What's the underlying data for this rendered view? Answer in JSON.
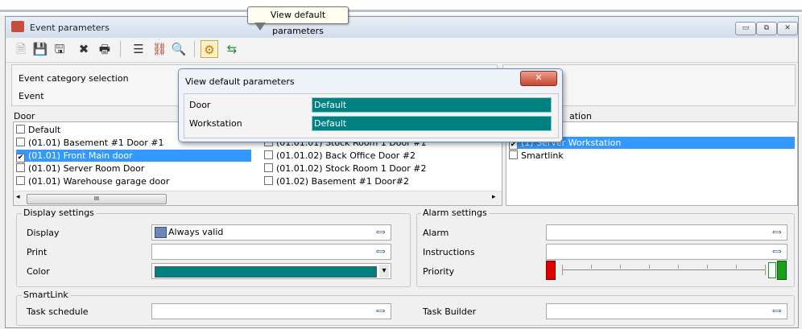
{
  "tooltip": "View default parameters",
  "window": {
    "title": "Event parameters",
    "controls": {
      "minimize": "▭",
      "restore": "⧉",
      "close": "✕"
    }
  },
  "toolbar": {
    "buttons": [
      {
        "name": "new-icon",
        "glyph": "🗎"
      },
      {
        "name": "save-icon",
        "glyph": "💾"
      },
      {
        "name": "save-as-icon",
        "glyph": "🖫"
      },
      {
        "name": "delete-icon",
        "glyph": "✖"
      },
      {
        "name": "print-icon",
        "glyph": "🖶"
      },
      {
        "name": "list-icon",
        "glyph": "☰"
      },
      {
        "name": "link-icon",
        "glyph": "⛓"
      },
      {
        "name": "search-icon",
        "glyph": "🔍"
      },
      {
        "name": "default-parameters-icon",
        "glyph": "⚙"
      },
      {
        "name": "export-icon",
        "glyph": "⇆"
      }
    ]
  },
  "header": {
    "category_label": "Event category selection",
    "event_label": "Event"
  },
  "door_list": {
    "title": "Door",
    "col1": [
      {
        "label": "Default",
        "checked": false,
        "selected": false
      },
      {
        "label": "(01.01) Basement #1 Door #1",
        "checked": false,
        "selected": false
      },
      {
        "label": "(01.01) Front Main door",
        "checked": true,
        "selected": true
      },
      {
        "label": "(01.01) Server Room Door",
        "checked": false,
        "selected": false
      },
      {
        "label": "(01.01) Warehouse garage door",
        "checked": false,
        "selected": false
      }
    ],
    "col2": [
      {
        "label": "(01.01.01) Stock Room 1 Door #1",
        "checked": false
      },
      {
        "label": "(01.01.02) Back Office Door #2",
        "checked": false
      },
      {
        "label": "(01.01.02) Stock Room 1 Door #2",
        "checked": false
      },
      {
        "label": "(01.02) Basement #1 Door#2",
        "checked": false
      }
    ],
    "scroll_left": "◂",
    "scroll_right": "▸",
    "scroll_grip": "III"
  },
  "workstation_list": {
    "title": "ation",
    "items": [
      {
        "label": "(1) Server Workstation",
        "checked": true,
        "selected": true
      },
      {
        "label": "Smartlink",
        "checked": false,
        "selected": false
      }
    ]
  },
  "dialog": {
    "title": "View default parameters",
    "close": "✕",
    "rows": [
      {
        "label": "Door",
        "value": "Default"
      },
      {
        "label": "Workstation",
        "value": "Default"
      }
    ]
  },
  "display_settings": {
    "title": "Display settings",
    "display_label": "Display",
    "display_value": "Always valid",
    "print_label": "Print",
    "color_label": "Color",
    "color_value": "#008080",
    "dropdown_arrow": "▾",
    "pick": "⟺"
  },
  "alarm_settings": {
    "title": "Alarm settings",
    "alarm_label": "Alarm",
    "instructions_label": "Instructions",
    "priority_label": "Priority",
    "pick": "⟺"
  },
  "smartlink": {
    "title": "SmartLink",
    "task_schedule_label": "Task schedule",
    "task_builder_label": "Task Builder",
    "pick": "⟺"
  },
  "colors": {
    "accent": "#3399ff",
    "teal": "#008080",
    "priority_low": "#e00000",
    "priority_high": "#18a018"
  }
}
